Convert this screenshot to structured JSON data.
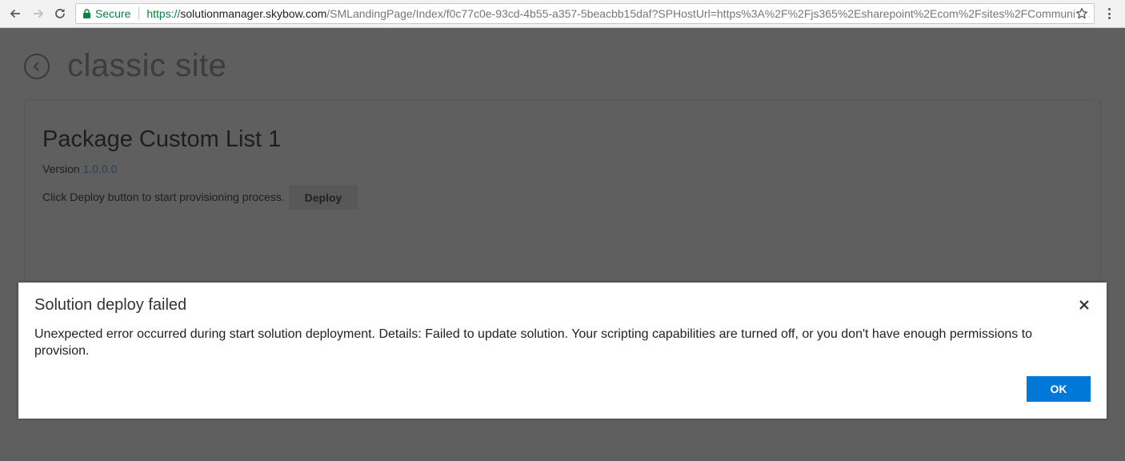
{
  "browser": {
    "secure_label": "Secure",
    "url_scheme": "https://",
    "url_host": "solutionmanager.skybow.com",
    "url_rest": "/SMLandingPage/Index/f0c77c0e-93cd-4b55-a357-5beacbb15daf?SPHostUrl=https%3A%2F%2Fjs365%2Esharepoint%2Ecom%2Fsites%2FCommunic..."
  },
  "page": {
    "site_title": "classic site",
    "package_title": "Package Custom List 1",
    "version_label": "Version",
    "version_number": "1.0.0.0",
    "deploy_instruction": "Click Deploy button to start provisioning process.",
    "deploy_button": "Deploy"
  },
  "dialog": {
    "title": "Solution deploy failed",
    "message": "Unexpected error occurred during start solution deployment. Details: Failed to update solution. Your scripting capabilities are turned off, or you don't have enough permissions to provision.",
    "ok_button": "OK"
  },
  "icons": {
    "back_nav": "arrow-left-icon",
    "forward_nav": "arrow-right-icon",
    "reload": "reload-icon",
    "lock": "lock-icon",
    "bookmark": "star-icon",
    "menu": "more-vert-icon",
    "page_back": "circle-back-icon",
    "close": "close-icon"
  },
  "colors": {
    "secure_green": "#0b8043",
    "ok_blue": "#0078d7",
    "overlay": "#5f5f5f"
  }
}
